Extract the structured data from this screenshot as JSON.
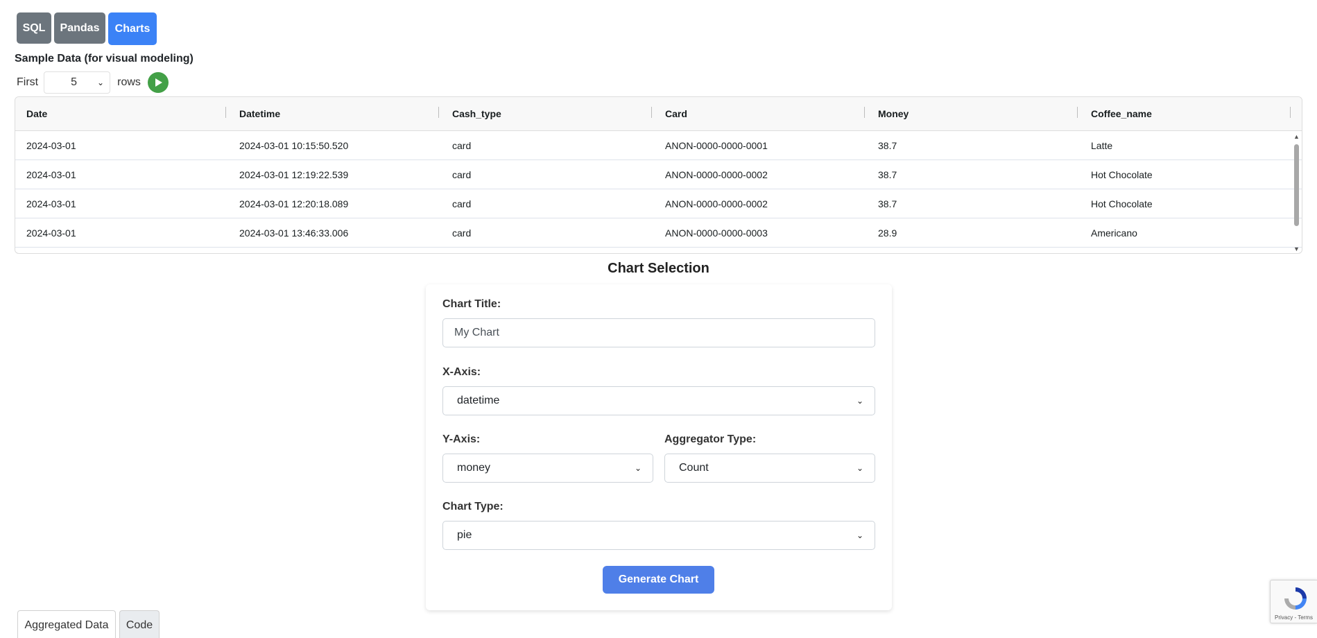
{
  "tabs": [
    {
      "label": "SQL"
    },
    {
      "label": "Pandas"
    },
    {
      "label": "Charts"
    }
  ],
  "sample": {
    "title": "Sample Data (for visual modeling)",
    "first_label": "First",
    "rows_value": "5",
    "rows_label": "rows"
  },
  "grid": {
    "headers": [
      "Date",
      "Datetime",
      "Cash_type",
      "Card",
      "Money",
      "Coffee_name"
    ],
    "rows": [
      [
        "2024-03-01",
        "2024-03-01 10:15:50.520",
        "card",
        "ANON-0000-0000-0001",
        "38.7",
        "Latte"
      ],
      [
        "2024-03-01",
        "2024-03-01 12:19:22.539",
        "card",
        "ANON-0000-0000-0002",
        "38.7",
        "Hot Chocolate"
      ],
      [
        "2024-03-01",
        "2024-03-01 12:20:18.089",
        "card",
        "ANON-0000-0000-0002",
        "38.7",
        "Hot Chocolate"
      ],
      [
        "2024-03-01",
        "2024-03-01 13:46:33.006",
        "card",
        "ANON-0000-0000-0003",
        "28.9",
        "Americano"
      ]
    ]
  },
  "chart_selection": {
    "heading": "Chart Selection",
    "title_label": "Chart Title:",
    "title_value": "My Chart",
    "x_label": "X-Axis:",
    "x_value": "datetime",
    "y_label": "Y-Axis:",
    "y_value": "money",
    "agg_label": "Aggregator Type:",
    "agg_value": "Count",
    "type_label": "Chart Type:",
    "type_value": "pie",
    "generate_label": "Generate Chart"
  },
  "bottom_tabs": {
    "aggregated": "Aggregated Data",
    "code": "Code"
  },
  "recaptcha": {
    "text": "Privacy - Terms"
  },
  "colors": {
    "accent": "#3b82f6",
    "tab_gray": "#6c757d",
    "run_green": "#43a047",
    "button_blue": "#4f7fe8"
  }
}
